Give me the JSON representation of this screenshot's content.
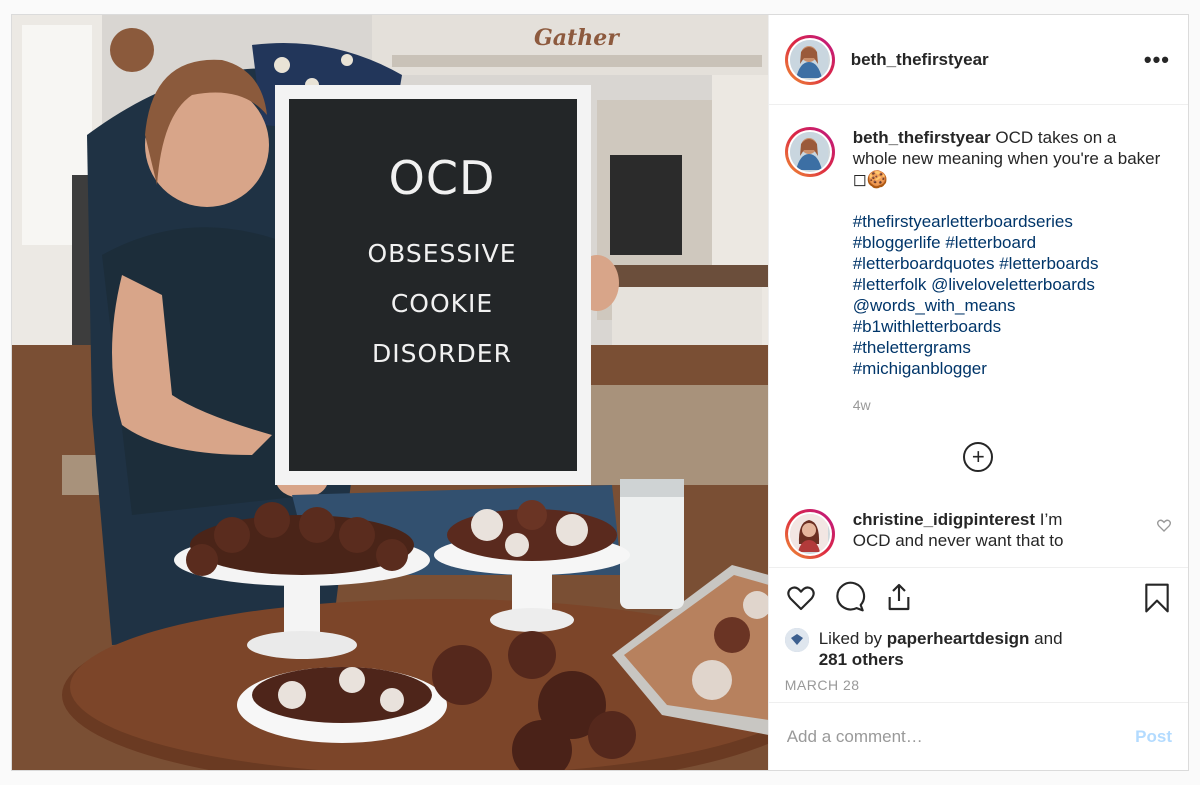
{
  "post": {
    "username": "beth_thefirstyear",
    "more_label": "•••",
    "image": {
      "board_title": "OCD",
      "board_line1": "OBSESSIVE",
      "board_line2": "COOKIE",
      "board_line3": "DISORDER",
      "wall_sign": "Gather"
    }
  },
  "caption": {
    "username": "beth_thefirstyear",
    "text": "OCD takes on a whole new meaning when you're a baker ◻🍪",
    "tags": [
      "#thefirstyearletterboardseries",
      "#bloggerlife #letterboard",
      "#letterboardquotes #letterboards",
      "#letterfolk @liveloveletterboards",
      "@words_with_means",
      "#b1withletterboards",
      "#thelettergrams",
      "#michiganblogger"
    ],
    "age": "4w"
  },
  "load_more_label": "+",
  "comment": {
    "username": "christine_idigpinterest",
    "text_line1": "I’m",
    "text_line2": "OCD and never want that to"
  },
  "likes": {
    "prefix": "Liked by",
    "user": "paperheartdesign",
    "and": "and",
    "count": "281 others"
  },
  "date": "MARCH 28",
  "add_comment": {
    "placeholder": "Add a comment…",
    "post_label": "Post"
  },
  "colors": {
    "link": "#003569",
    "muted": "#999999",
    "post_disabled": "#b3dbff",
    "story_ring": "#dc2743"
  }
}
